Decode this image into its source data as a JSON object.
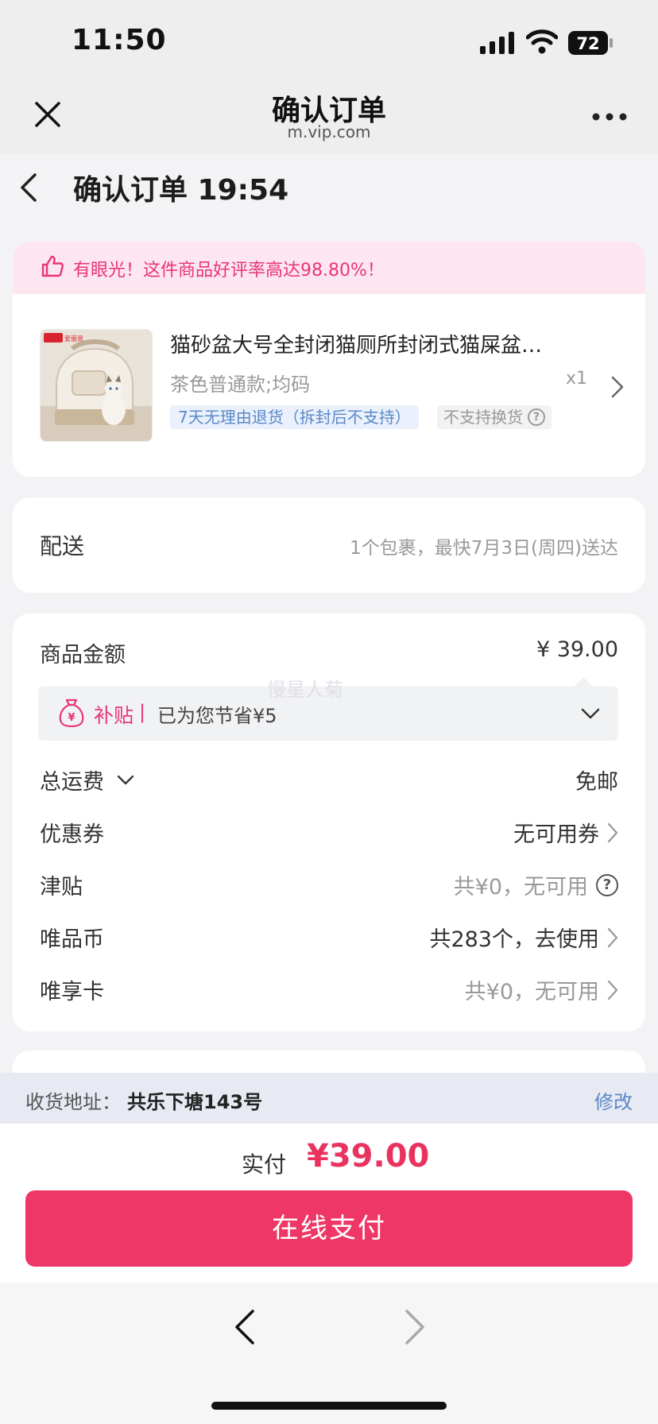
{
  "status_bar": {
    "time": "11:50",
    "battery": "72"
  },
  "browser": {
    "title": "确认订单",
    "domain": "m.vip.com"
  },
  "page": {
    "title": "确认订单 19:54"
  },
  "praise": {
    "text": "有眼光！这件商品好评率高达98.80%！"
  },
  "product": {
    "title": "猫砂盆大号全封闭猫厕所封闭式猫屎盆…",
    "spec": "茶色普通款;均码",
    "qty": "x1",
    "tag_return": "7天无理由退货（拆封后不支持）",
    "tag_no_exchange": "不支持换货",
    "brand_mini": "爱丽思"
  },
  "shipping": {
    "label": "配送",
    "info": "1个包裹，最快7月3日(周四)送达"
  },
  "amounts": {
    "goods_label": "商品金额",
    "goods_value": "¥ 39.00",
    "subsidy_label": "补贴",
    "subsidy_sep": "|",
    "subsidy_text": "已为您节省¥5",
    "shipping_fee_label": "总运费",
    "shipping_fee_value": "免邮",
    "coupon_label": "优惠券",
    "coupon_value": "无可用券",
    "allowance_label": "津贴",
    "allowance_value": "共¥0，无可用",
    "coins_label": "唯品币",
    "coins_value": "共283个，去使用",
    "card_label": "唯享卡",
    "card_value": "共¥0，无可用"
  },
  "watermark": "慢星人菊",
  "address": {
    "label": "收货地址：",
    "value": "共乐下塘143号",
    "edit": "修改"
  },
  "payment": {
    "label": "实付",
    "amount": "¥39.00",
    "button": "在线支付"
  },
  "colors": {
    "accent": "#ee3766",
    "pink_text": "#e8357a",
    "link_blue": "#5a88c8"
  }
}
